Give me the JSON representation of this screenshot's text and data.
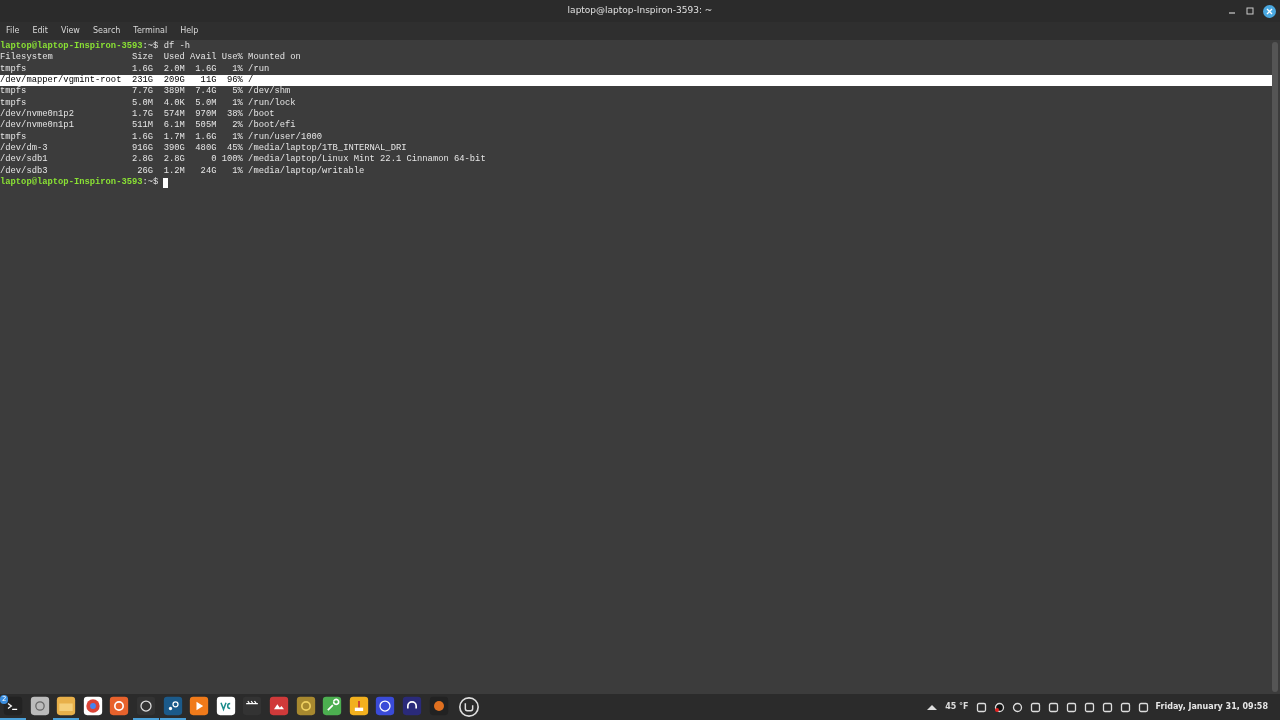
{
  "window": {
    "title": "laptop@laptop-Inspiron-3593: ~"
  },
  "menu": [
    "File",
    "Edit",
    "View",
    "Search",
    "Terminal",
    "Help"
  ],
  "terminal": {
    "lines": [
      {
        "kind": "prompt",
        "user_host": "laptop@laptop-Inspiron-3593",
        "path": ":~$",
        "command": " df -h",
        "cursor": false,
        "selected": false
      },
      {
        "kind": "output",
        "text": "Filesystem               Size  Used Avail Use% Mounted on",
        "selected": false
      },
      {
        "kind": "output",
        "text": "tmpfs                    1.6G  2.0M  1.6G   1% /run",
        "selected": false
      },
      {
        "kind": "output",
        "text": "/dev/mapper/vgmint-root  231G  209G   11G  96% /",
        "selected": true
      },
      {
        "kind": "output",
        "text": "tmpfs                    7.7G  389M  7.4G   5% /dev/shm",
        "selected": false
      },
      {
        "kind": "output",
        "text": "tmpfs                    5.0M  4.0K  5.0M   1% /run/lock",
        "selected": false
      },
      {
        "kind": "output",
        "text": "/dev/nvme0n1p2           1.7G  574M  970M  38% /boot",
        "selected": false
      },
      {
        "kind": "output",
        "text": "/dev/nvme0n1p1           511M  6.1M  505M   2% /boot/efi",
        "selected": false
      },
      {
        "kind": "output",
        "text": "tmpfs                    1.6G  1.7M  1.6G   1% /run/user/1000",
        "selected": false
      },
      {
        "kind": "output",
        "text": "/dev/dm-3                916G  390G  480G  45% /media/laptop/1TB_INTERNAL_DRI",
        "selected": false
      },
      {
        "kind": "output",
        "text": "/dev/sdb1                2.8G  2.8G     0 100% /media/laptop/Linux Mint 22.1 Cinnamon 64-bit",
        "selected": false
      },
      {
        "kind": "output",
        "text": "/dev/sdb3                 26G  1.2M   24G   1% /media/laptop/writable",
        "selected": false
      },
      {
        "kind": "prompt",
        "user_host": "laptop@laptop-Inspiron-3593",
        "path": ":~$",
        "cursor": true,
        "selected": false
      }
    ]
  },
  "taskbar": {
    "launchers": [
      {
        "running": true,
        "badge": "2"
      },
      {
        "running": false
      },
      {
        "running": true
      },
      {
        "running": false
      },
      {
        "running": false
      },
      {
        "running": true
      },
      {
        "running": true
      },
      {
        "running": false
      },
      {
        "running": false
      },
      {
        "running": false
      },
      {
        "running": false
      },
      {
        "running": false
      },
      {
        "running": false
      },
      {
        "running": false
      },
      {
        "running": false
      },
      {
        "running": false
      },
      {
        "running": false
      }
    ],
    "weather": "45 °F",
    "clock": "Friday, January 31, 09:58"
  }
}
